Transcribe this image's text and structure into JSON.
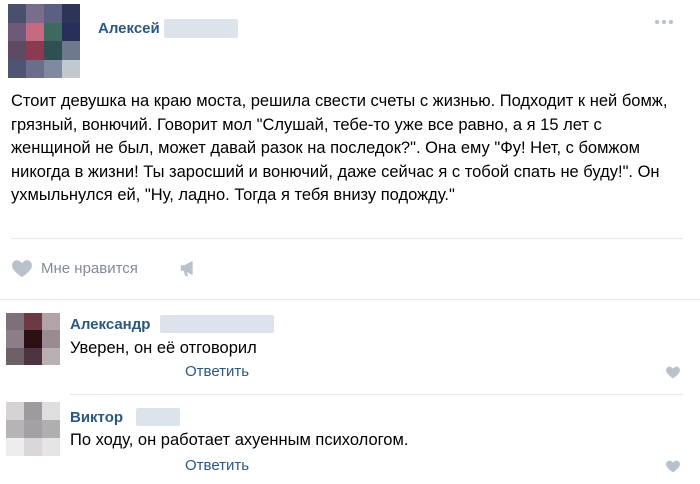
{
  "post": {
    "author": "Алексей",
    "text": "Стоит девушка на краю моста, решила свести счеты с жизнью. Подходит к ней бомж, грязный, вонючий. Говорит мол \"Слушай, тебе-то уже все равно, а я 15 лет с женщиной не был, может давай разок на последок?\". Она ему \"Фу! Нет, с бомжом никогда в жизни! Ты заросший и вонючий, даже сейчас я с тобой спать не буду!\". Он ухмыльнулся ей, \"Ну, ладно. Тогда я тебя внизу подожду.\"",
    "like_label": "Мне нравится",
    "more_icon": "ellipsis-icon",
    "like_icon": "heart-icon",
    "share_icon": "megaphone-icon"
  },
  "comments": [
    {
      "author": "Александр",
      "text": "Уверен, он её отговорил",
      "reply_label": "Ответить"
    },
    {
      "author": "Виктор",
      "text": "По ходу, он работает ахуенным психологом.",
      "reply_label": "Ответить"
    }
  ],
  "colors": {
    "link": "#2a5885",
    "muted": "#828a99",
    "icon": "#b8c1cc",
    "divider": "#e7e8ec"
  }
}
